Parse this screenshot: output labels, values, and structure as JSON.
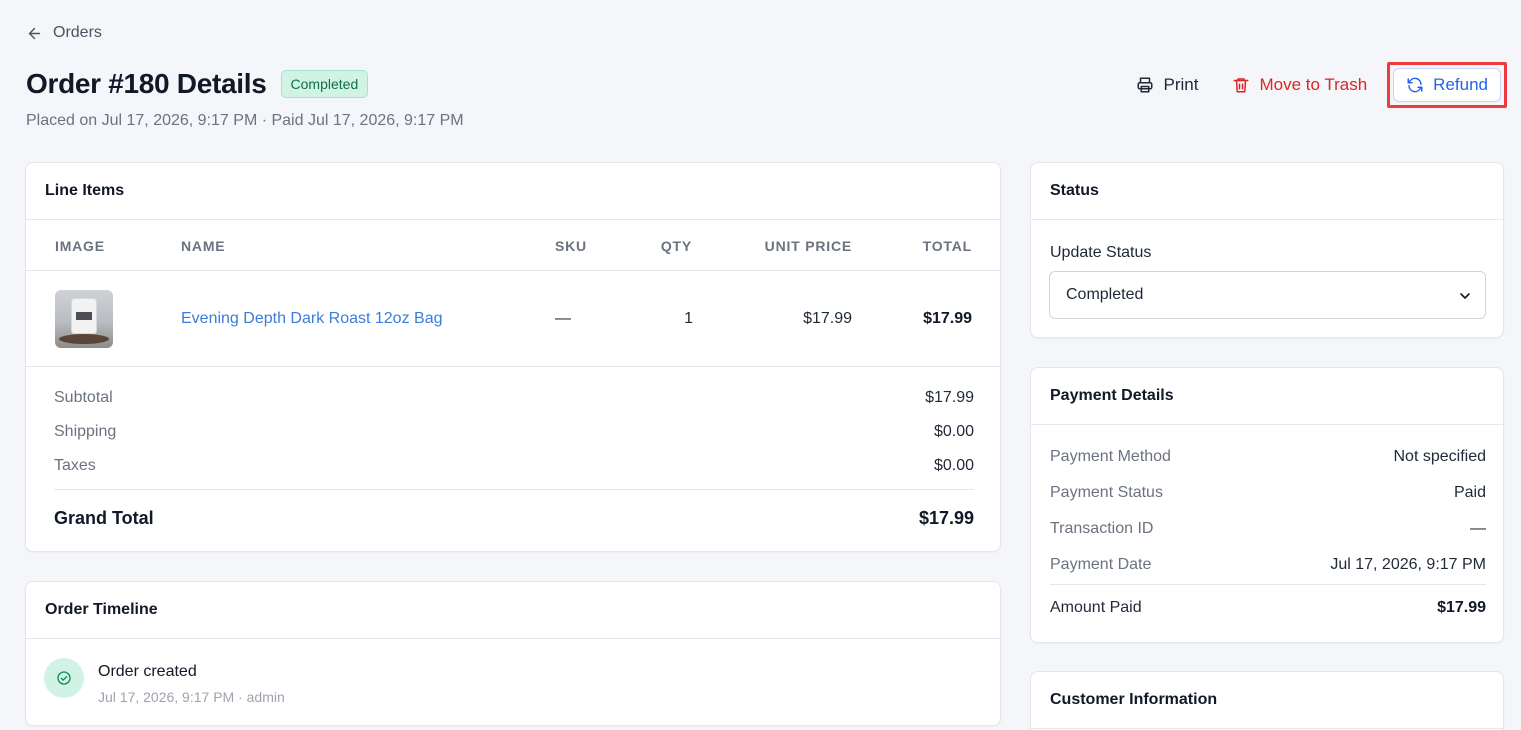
{
  "nav": {
    "back_label": "Orders"
  },
  "header": {
    "title": "Order #180 Details",
    "status_badge": "Completed",
    "subtitle": "Placed on Jul 17, 2026, 9:17 PM · Paid Jul 17, 2026, 9:17 PM"
  },
  "actions": {
    "print_label": "Print",
    "trash_label": "Move to Trash",
    "refund_label": "Refund"
  },
  "line_items": {
    "title": "Line Items",
    "columns": [
      "IMAGE",
      "NAME",
      "SKU",
      "QTY",
      "UNIT PRICE",
      "TOTAL"
    ],
    "rows": [
      {
        "name": "Evening Depth Dark Roast 12oz Bag",
        "sku": "—",
        "qty": "1",
        "unit_price": "$17.99",
        "total": "$17.99"
      }
    ],
    "summary": {
      "subtotal_label": "Subtotal",
      "subtotal": "$17.99",
      "shipping_label": "Shipping",
      "shipping": "$0.00",
      "taxes_label": "Taxes",
      "taxes": "$0.00",
      "grand_total_label": "Grand Total",
      "grand_total": "$17.99"
    }
  },
  "timeline": {
    "title": "Order Timeline",
    "events": [
      {
        "title": "Order created",
        "meta": "Jul 17, 2026, 9:17 PM · admin"
      }
    ]
  },
  "status_panel": {
    "title": "Status",
    "field_label": "Update Status",
    "selected": "Completed"
  },
  "payment": {
    "title": "Payment Details",
    "rows": [
      {
        "label": "Payment Method",
        "value": "Not specified"
      },
      {
        "label": "Payment Status",
        "value": "Paid"
      },
      {
        "label": "Transaction ID",
        "value": "—"
      },
      {
        "label": "Payment Date",
        "value": "Jul 17, 2026, 9:17 PM"
      }
    ],
    "amount_label": "Amount Paid",
    "amount": "$17.99"
  },
  "customer": {
    "title": "Customer Information"
  },
  "colors": {
    "accent": "#2563eb",
    "link": "#3b7dd8",
    "danger": "#dc2626",
    "success_bg": "#d1f3e6",
    "success_text": "#0f6e4c",
    "highlight": "#ef3b3b"
  },
  "icons": [
    "arrow-left-icon",
    "printer-icon",
    "trash-icon",
    "refresh-icon",
    "check-circle-icon",
    "chevron-down-icon"
  ]
}
